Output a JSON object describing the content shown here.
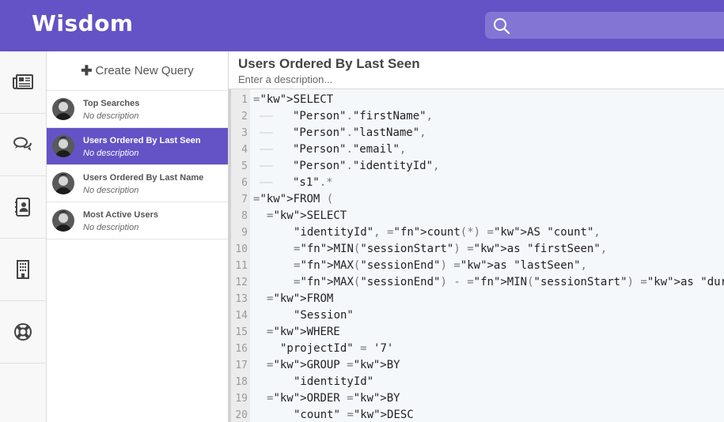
{
  "app": {
    "name": "Wisdom"
  },
  "search": {
    "placeholder": ""
  },
  "nav": {
    "items": [
      {
        "icon": "news-icon"
      },
      {
        "icon": "chat-icon"
      },
      {
        "icon": "contacts-icon"
      },
      {
        "icon": "building-icon"
      },
      {
        "icon": "lifebuoy-icon"
      }
    ]
  },
  "queries": {
    "create_label": "Create New Query",
    "items": [
      {
        "title": "Top Searches",
        "desc": "No description",
        "active": false
      },
      {
        "title": "Users Ordered By Last Seen",
        "desc": "No description",
        "active": true
      },
      {
        "title": "Users Ordered By Last Name",
        "desc": "No description",
        "active": false
      },
      {
        "title": "Most Active Users",
        "desc": "No description",
        "active": false
      }
    ]
  },
  "editor": {
    "title": "Users Ordered By Last Seen",
    "description_placeholder": "Enter a description...",
    "lines": [
      {
        "n": "1",
        "code": "SELECT"
      },
      {
        "n": "2",
        "code": "\"Person\".\"firstName\","
      },
      {
        "n": "3",
        "code": "\"Person\".\"lastName\","
      },
      {
        "n": "4",
        "code": "\"Person\".\"email\","
      },
      {
        "n": "5",
        "code": "\"Person\".\"identityId\","
      },
      {
        "n": "6",
        "code": "\"s1\".*"
      },
      {
        "n": "7",
        "code": "FROM ("
      },
      {
        "n": "8",
        "code": "SELECT"
      },
      {
        "n": "9",
        "code": "\"identityId\", count(*) AS \"count\","
      },
      {
        "n": "10",
        "code": "MIN(\"sessionStart\") as \"firstSeen\","
      },
      {
        "n": "11",
        "code": "MAX(\"sessionEnd\") as \"lastSeen\","
      },
      {
        "n": "12",
        "code": "MAX(\"sessionEnd\") - MIN(\"sessionStart\") as \"duration\""
      },
      {
        "n": "13",
        "code": "FROM"
      },
      {
        "n": "14",
        "code": "\"Session\""
      },
      {
        "n": "15",
        "code": "WHERE"
      },
      {
        "n": "16",
        "code": "\"projectId\" = '7'"
      },
      {
        "n": "17",
        "code": "GROUP BY"
      },
      {
        "n": "18",
        "code": "\"identityId\""
      },
      {
        "n": "19",
        "code": "ORDER BY"
      },
      {
        "n": "20",
        "code": "\"count\" DESC"
      }
    ]
  },
  "colors": {
    "brand": "#6353c6",
    "keyword": "#4b46c8",
    "function": "#2fc2a1"
  }
}
